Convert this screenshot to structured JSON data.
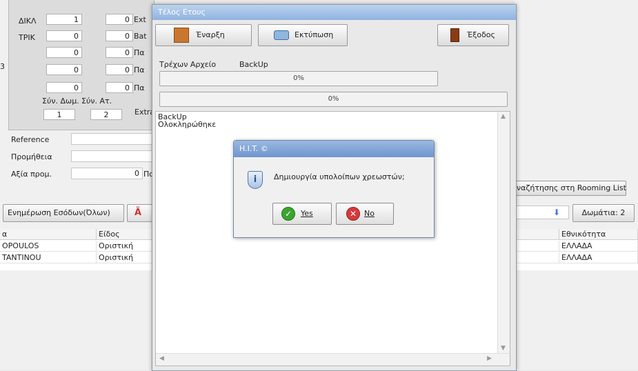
{
  "left_panel": {
    "rows": [
      {
        "label": "ΔΙΚΛ",
        "a": "1",
        "b": "0",
        "suffix": "Ext"
      },
      {
        "label": "ΤΡΙΚ",
        "a": "0",
        "b": "0",
        "suffix": "Bat"
      },
      {
        "label": "",
        "a": "0",
        "b": "0",
        "suffix": "Πα"
      },
      {
        "label": "",
        "a": "0",
        "b": "0",
        "suffix": "Πα"
      },
      {
        "label": "",
        "a": "0",
        "b": "0",
        "suffix": "Πα"
      }
    ],
    "sum_rooms_label": "Σύν. Δωμ.",
    "sum_rooms_value": "1",
    "sum_persons_label": "Σύν. Ατ.",
    "sum_persons_value": "2",
    "extra_label": "Extra",
    "side_num": "3"
  },
  "fields": [
    {
      "label": "Reference",
      "value": ""
    },
    {
      "label": "Προμήθεια",
      "value": ""
    },
    {
      "label": "Αξία προμ.",
      "value": "0",
      "suffix": "Πο"
    }
  ],
  "toolbar": {
    "update_income_label": "Ενημέρωση Εσόδων(Όλων)",
    "rooming_search_label": "ναζήτησης στη Rooming List",
    "rooms_label": "Δωμάτια: 2"
  },
  "table": {
    "headers": [
      "α",
      "Είδος"
    ],
    "right_header": "Εθνικότητα",
    "rows": [
      {
        "name": "OPOULOS",
        "type": "Οριστική",
        "nationality": "ΕΛΛΑΔΑ"
      },
      {
        "name": "TANTINOU",
        "type": "Οριστική",
        "nationality": "ΕΛΛΑΔΑ"
      }
    ]
  },
  "window": {
    "title": "Τέλος Ετους",
    "start_label": "Έναρξη",
    "print_label": "Εκτύπωση",
    "exit_label": "Έξοδος",
    "current_file_label": "Τρέχων Αρχείο",
    "current_file_value": "BackUp",
    "progress1": {
      "text": "0%",
      "percent": 0
    },
    "progress2": {
      "text": "0%",
      "percent": 0
    },
    "log_lines": [
      "BackUp",
      "Ολοκληρώθηκε"
    ]
  },
  "dialog": {
    "title": "H.I.T. ©",
    "message": "Δημιουργία υπολοίπων χρεωστών;",
    "yes_label": "Yes",
    "no_label": "No"
  },
  "colors": {
    "title_bar": "#8fb3df",
    "dialog_title": "#6f96cf",
    "yes_icon": "#3aa52e",
    "no_icon": "#d63a3a"
  }
}
